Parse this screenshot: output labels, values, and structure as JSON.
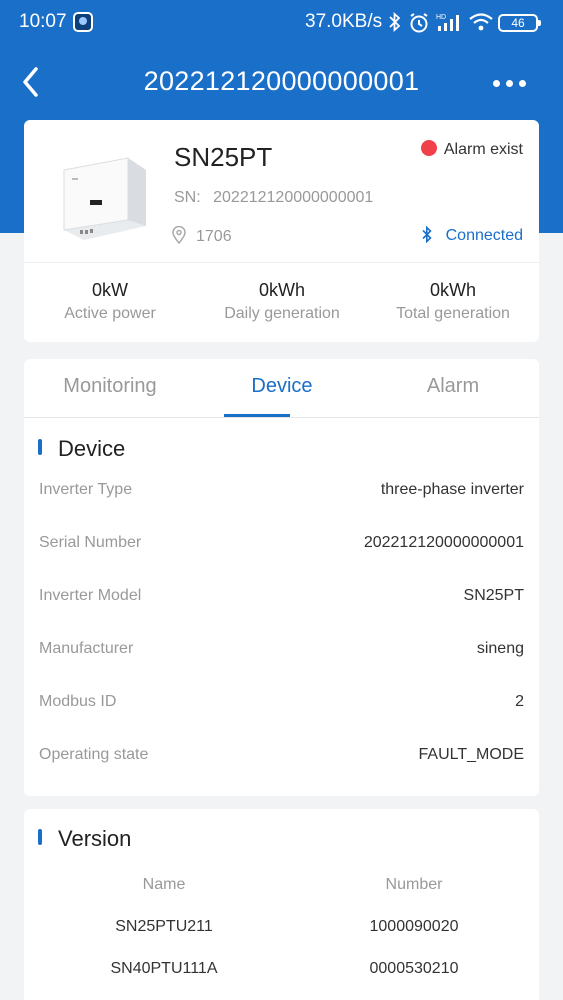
{
  "status_bar": {
    "time": "10:07",
    "network_speed": "37.0KB/s",
    "battery": "46"
  },
  "nav": {
    "title": "202212120000000001"
  },
  "device": {
    "name": "SN25PT",
    "sn_label": "SN:",
    "sn_value": "202212120000000001",
    "location": "1706",
    "alarm_status": "Alarm exist",
    "alarm_color": "#f0404a",
    "connection_status": "Connected",
    "stats": [
      {
        "value": "0kW",
        "label": "Active power"
      },
      {
        "value": "0kWh",
        "label": "Daily generation"
      },
      {
        "value": "0kWh",
        "label": "Total generation"
      }
    ]
  },
  "tabs": [
    {
      "label": "Monitoring",
      "active": false
    },
    {
      "label": "Device",
      "active": true
    },
    {
      "label": "Alarm",
      "active": false
    }
  ],
  "device_section": {
    "title": "Device",
    "rows": [
      {
        "key": "Inverter Type",
        "value": "three-phase inverter"
      },
      {
        "key": "Serial Number",
        "value": "202212120000000001"
      },
      {
        "key": "Inverter Model",
        "value": "SN25PT"
      },
      {
        "key": "Manufacturer",
        "value": "sineng"
      },
      {
        "key": "Modbus ID",
        "value": "2"
      },
      {
        "key": "Operating state",
        "value": "FAULT_MODE"
      }
    ]
  },
  "version_section": {
    "title": "Version",
    "headers": {
      "name": "Name",
      "number": "Number"
    },
    "rows": [
      {
        "name": "SN25PTU211",
        "number": "1000090020"
      },
      {
        "name": "SN40PTU111A",
        "number": "0000530210"
      }
    ]
  },
  "colors": {
    "primary": "#1a6fc9",
    "background": "#f2f3f5"
  }
}
